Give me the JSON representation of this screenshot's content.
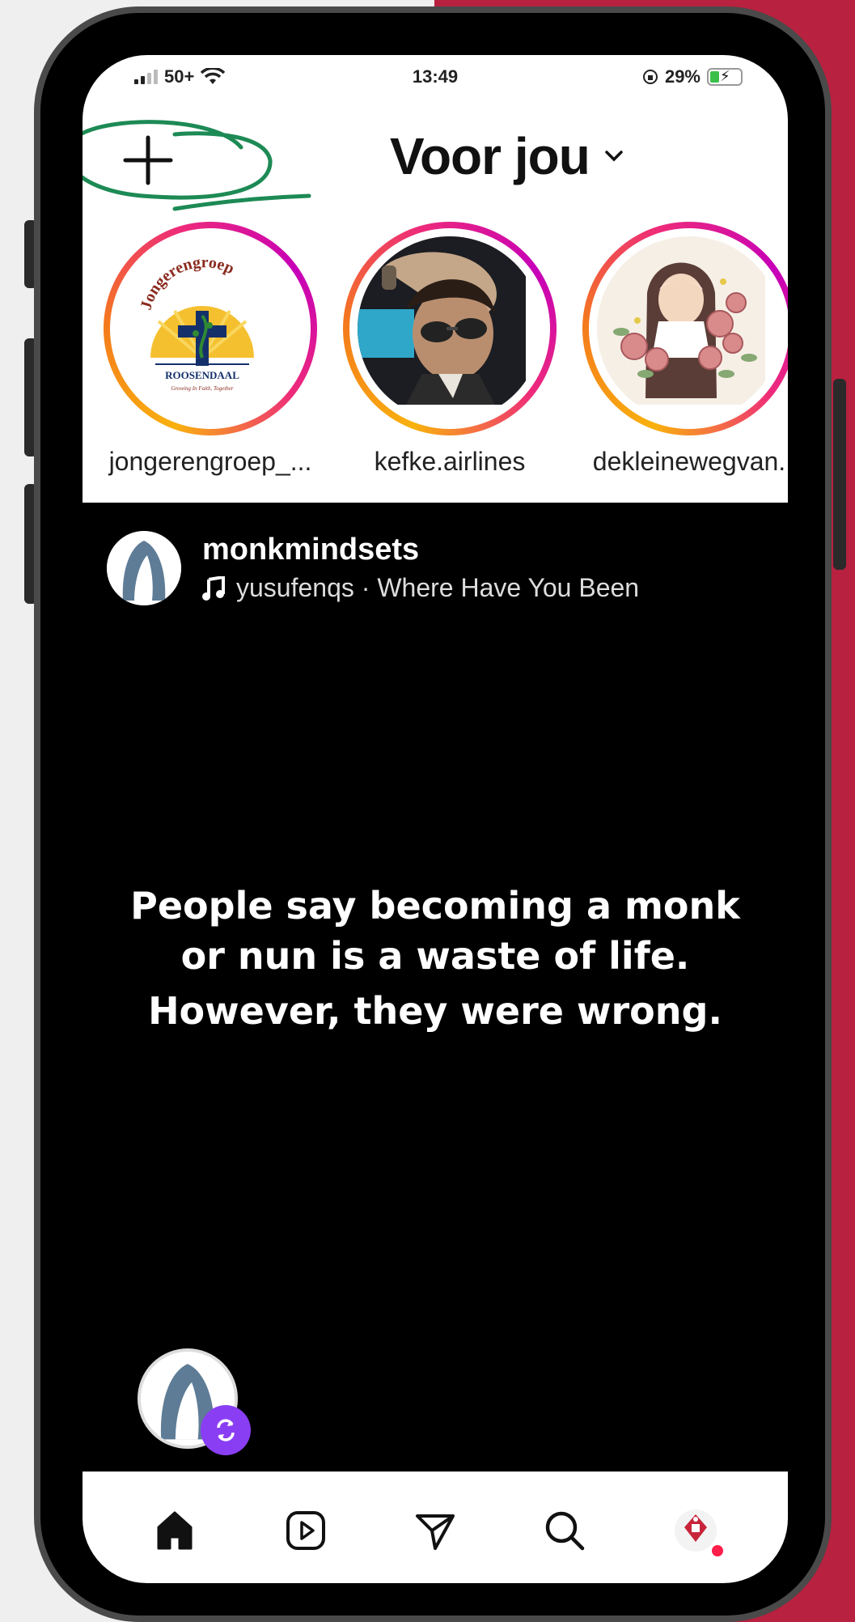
{
  "status_bar": {
    "carrier": "50+",
    "time": "13:49",
    "battery": "29%"
  },
  "header": {
    "title": "Voor jou"
  },
  "stories": [
    {
      "username": "jongerengroep_..."
    },
    {
      "username": "kefke.airlines"
    },
    {
      "username": "dekleinewegvan."
    }
  ],
  "story_logo": {
    "arc_text": "Jongerengroep",
    "place": "ROOSENDAAL",
    "tagline": "Growing In Faith, Together"
  },
  "post": {
    "username": "monkmindsets",
    "audio": "yusufenqs · Where Have You Been",
    "caption_lines": [
      "People say becoming a monk",
      "or nun is a waste of life.",
      "However, they were wrong."
    ]
  },
  "colors": {
    "background_red": "#b8213f",
    "story_ring": "#ee2a7b",
    "annotation_green": "#1d8a55",
    "remix_badge": "#8a3ef3",
    "notification_dot": "#ff1d49"
  },
  "icons": {
    "create": "plus-icon",
    "feed_switch": "chevron-down-icon",
    "nav": [
      "home-icon",
      "reels-icon",
      "messages-icon",
      "search-icon",
      "profile-icon"
    ]
  }
}
